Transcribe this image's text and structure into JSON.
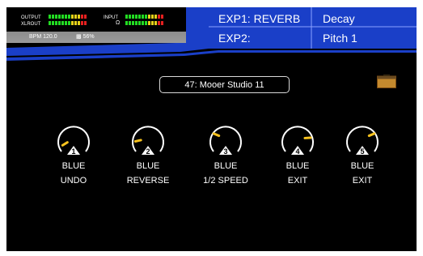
{
  "meters": {
    "output_label": "OUTPUT",
    "xlrout_label": "XLROUT",
    "input_label": "INPUT",
    "headphone_icon": "headphone-icon"
  },
  "status": {
    "bpm": "BPM 120.0",
    "cpu": "56%",
    "cpu_icon": "cpu-icon"
  },
  "exp": {
    "exp1_label": "EXP1: REVERB",
    "exp1_value": "Decay",
    "exp2_label": "EXP2:",
    "exp2_value": "Pitch 1"
  },
  "preset": {
    "name": "47: Mooer Studio 11"
  },
  "amp_icon": "amp-icon",
  "knobs": [
    {
      "number": "1",
      "color": "BLUE",
      "function": "UNDO",
      "level": 0.05
    },
    {
      "number": "2",
      "color": "BLUE",
      "function": "REVERSE",
      "level": 0.12
    },
    {
      "number": "3",
      "color": "BLUE",
      "function": "1/2 SPEED",
      "level": 0.25
    },
    {
      "number": "4",
      "color": "BLUE",
      "function": "EXIT",
      "level": 0.82
    },
    {
      "number": "5",
      "color": "BLUE",
      "function": "EXIT",
      "level": 0.75
    }
  ],
  "colors": {
    "accent_blue": "#1a3fc8",
    "knob_pointer": "#f7c21e",
    "meter_green": "#22dd22",
    "meter_yellow": "#e6d21a",
    "meter_red": "#e62020"
  }
}
